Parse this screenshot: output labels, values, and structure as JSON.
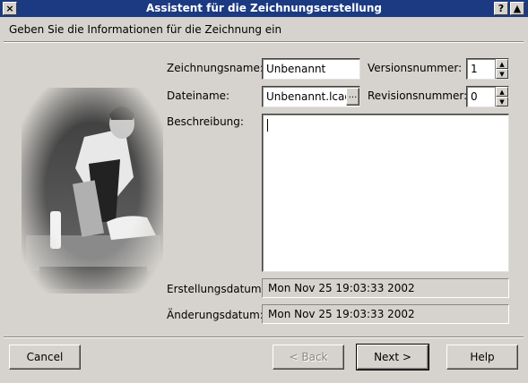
{
  "window": {
    "title": "Assistent für die Zeichnungserstellung",
    "close_glyph": "×",
    "help_glyph": "?",
    "shade_glyph": "▲"
  },
  "header": {
    "text": "Geben Sie die Informationen für die Zeichnung ein"
  },
  "form": {
    "name_label": "Zeichnungsname:",
    "name_value": "Unbenannt",
    "version_label": "Versionsnummer:",
    "version_value": "1",
    "file_label": "Dateiname:",
    "file_value": "Unbenannt.lcad",
    "browse_label": "...",
    "revision_label": "Revisionsnummer:",
    "revision_value": "0",
    "desc_label": "Beschreibung:",
    "desc_value": "",
    "created_label": "Erstellungsdatum:",
    "created_value": "Mon Nov 25 19:03:33 2002",
    "changed_label": "Änderungsdatum:",
    "changed_value": "Mon Nov 25 19:03:33 2002"
  },
  "buttons": {
    "cancel": "Cancel",
    "back": "< Back",
    "next": "Next >",
    "help": "Help"
  }
}
